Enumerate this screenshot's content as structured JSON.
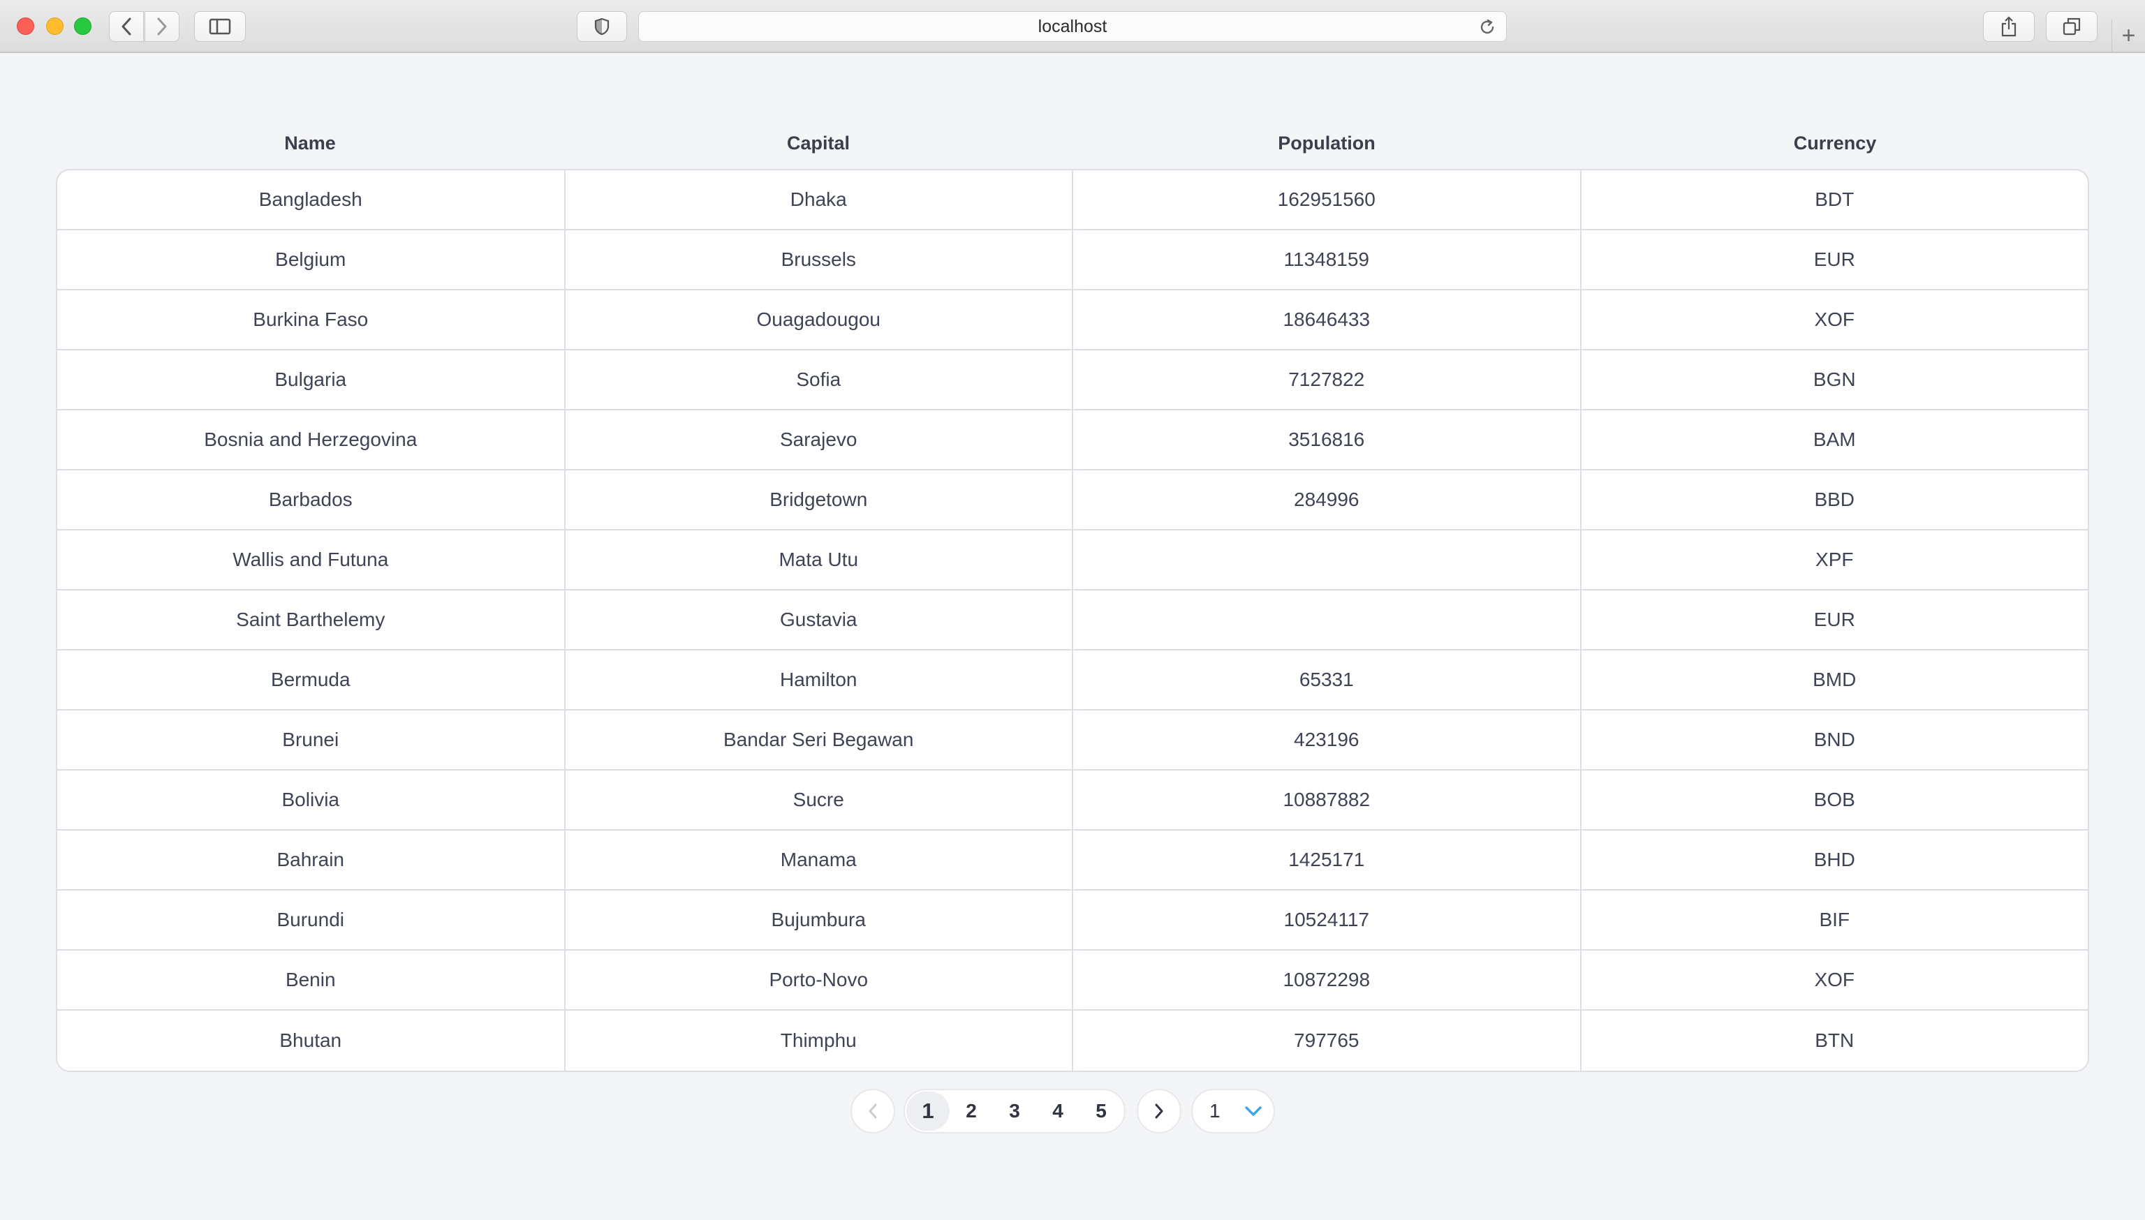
{
  "browser": {
    "url": "localhost"
  },
  "table": {
    "headers": [
      "Name",
      "Capital",
      "Population",
      "Currency"
    ],
    "rows": [
      [
        "Bangladesh",
        "Dhaka",
        "162951560",
        "BDT"
      ],
      [
        "Belgium",
        "Brussels",
        "11348159",
        "EUR"
      ],
      [
        "Burkina Faso",
        "Ouagadougou",
        "18646433",
        "XOF"
      ],
      [
        "Bulgaria",
        "Sofia",
        "7127822",
        "BGN"
      ],
      [
        "Bosnia and Herzegovina",
        "Sarajevo",
        "3516816",
        "BAM"
      ],
      [
        "Barbados",
        "Bridgetown",
        "284996",
        "BBD"
      ],
      [
        "Wallis and Futuna",
        "Mata Utu",
        "",
        "XPF"
      ],
      [
        "Saint Barthelemy",
        "Gustavia",
        "",
        "EUR"
      ],
      [
        "Bermuda",
        "Hamilton",
        "65331",
        "BMD"
      ],
      [
        "Brunei",
        "Bandar Seri Begawan",
        "423196",
        "BND"
      ],
      [
        "Bolivia",
        "Sucre",
        "10887882",
        "BOB"
      ],
      [
        "Bahrain",
        "Manama",
        "1425171",
        "BHD"
      ],
      [
        "Burundi",
        "Bujumbura",
        "10524117",
        "BIF"
      ],
      [
        "Benin",
        "Porto-Novo",
        "10872298",
        "XOF"
      ],
      [
        "Bhutan",
        "Thimphu",
        "797765",
        "BTN"
      ]
    ]
  },
  "pagination": {
    "pages": [
      "1",
      "2",
      "3",
      "4",
      "5"
    ],
    "current_page": "1",
    "page_size": "1"
  },
  "colors": {
    "page_background": "#f4f5f7",
    "accent": "#3aa6e6"
  },
  "icons": {
    "back": "chevron-left-icon",
    "forward": "chevron-right-icon",
    "sidebar": "sidebar-icon",
    "shield": "shield-icon",
    "reload": "reload-icon",
    "share": "share-icon",
    "tabs": "tabs-icon",
    "new_tab": "plus-icon",
    "prev_page": "chevron-left-icon",
    "next_page": "chevron-right-icon",
    "dropdown": "chevron-down-icon"
  }
}
